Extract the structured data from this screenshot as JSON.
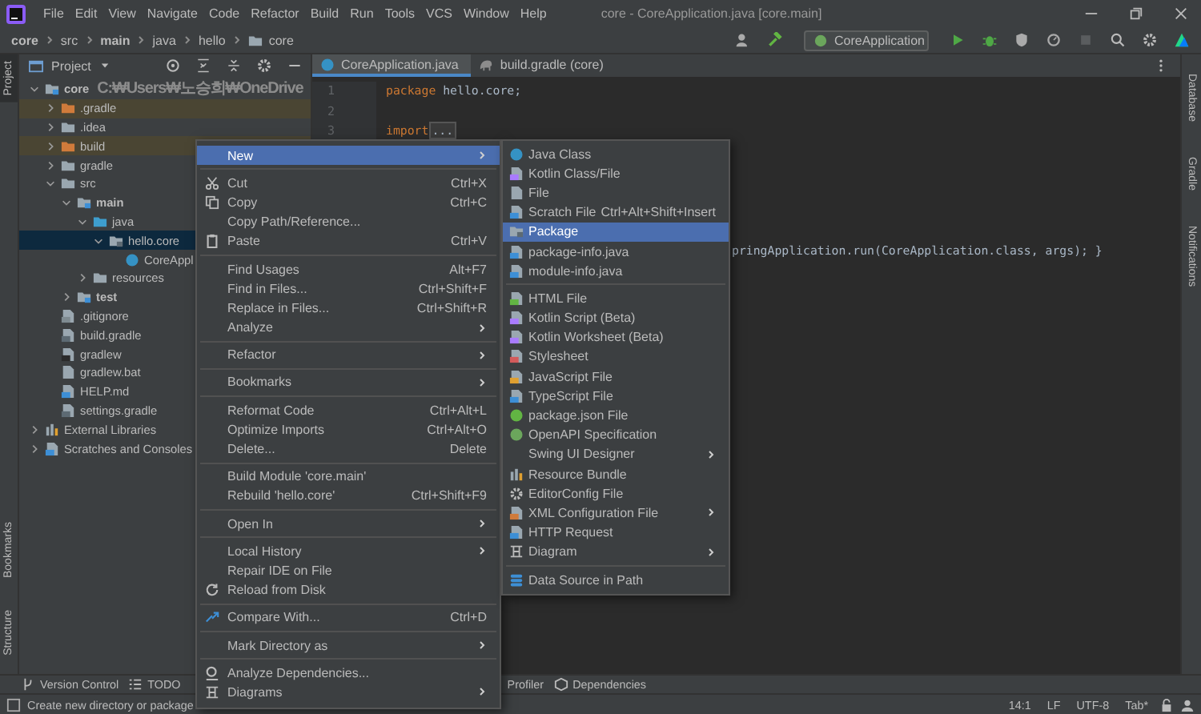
{
  "window": {
    "title": "core - CoreApplication.java [core.main]"
  },
  "menu_bar": [
    "File",
    "Edit",
    "View",
    "Navigate",
    "Code",
    "Refactor",
    "Build",
    "Run",
    "Tools",
    "VCS",
    "Window",
    "Help"
  ],
  "breadcrumbs": [
    {
      "label": "core",
      "kind": "module"
    },
    {
      "label": "src",
      "kind": "folder"
    },
    {
      "label": "main",
      "kind": "module"
    },
    {
      "label": "java",
      "kind": "folder"
    },
    {
      "label": "hello",
      "kind": "folder"
    },
    {
      "label": "core",
      "kind": "package"
    }
  ],
  "run_config": {
    "label": "CoreApplication"
  },
  "left_stripe": {
    "top": [
      {
        "label": "Project",
        "selected": true
      }
    ],
    "bottom": [
      {
        "label": "Bookmarks",
        "selected": false
      },
      {
        "label": "Structure",
        "selected": false
      }
    ]
  },
  "right_stripe": [
    "Database",
    "Gradle",
    "Notifications"
  ],
  "project_panel": {
    "title": "Project",
    "tree": [
      {
        "label": "core",
        "kind": "module",
        "path": "C:₩Users₩노승희₩OneDrive",
        "expanded": true,
        "selected": false,
        "children": [
          {
            "label": ".gradle",
            "kind": "excluded",
            "expanded": false,
            "selected": false
          },
          {
            "label": ".idea",
            "kind": "folder",
            "expanded": false,
            "selected": false
          },
          {
            "label": "build",
            "kind": "excluded",
            "expanded": false,
            "selected": false
          },
          {
            "label": "gradle",
            "kind": "folder",
            "expanded": false,
            "selected": false
          },
          {
            "label": "src",
            "kind": "folder",
            "expanded": true,
            "selected": false,
            "children": [
              {
                "label": "main",
                "kind": "source-set",
                "expanded": true,
                "selected": false,
                "children": [
                  {
                    "label": "java",
                    "kind": "java-root",
                    "expanded": true,
                    "selected": false,
                    "children": [
                      {
                        "label": "hello.core",
                        "kind": "package",
                        "expanded": true,
                        "selected": true,
                        "children": [
                          {
                            "label": "CoreAppl",
                            "kind": "class",
                            "selected": false
                          }
                        ]
                      }
                    ]
                  },
                  {
                    "label": "resources",
                    "kind": "folder",
                    "expanded": false,
                    "selected": false
                  }
                ]
              },
              {
                "label": "test",
                "kind": "source-set",
                "expanded": false,
                "selected": false
              }
            ]
          },
          {
            "label": ".gitignore",
            "kind": "gitignore",
            "selected": false
          },
          {
            "label": "build.gradle",
            "kind": "gradle",
            "selected": false
          },
          {
            "label": "gradlew",
            "kind": "script",
            "selected": false
          },
          {
            "label": "gradlew.bat",
            "kind": "batch",
            "selected": false
          },
          {
            "label": "HELP.md",
            "kind": "markdown",
            "selected": false
          },
          {
            "label": "settings.gradle",
            "kind": "gradle",
            "selected": false
          }
        ]
      },
      {
        "label": "External Libraries",
        "kind": "libraries",
        "expanded": false,
        "selected": false
      },
      {
        "label": "Scratches and Consoles",
        "kind": "scratches",
        "expanded": false,
        "selected": false
      }
    ]
  },
  "editor": {
    "tabs": [
      {
        "label": "CoreApplication.java",
        "kind": "java",
        "selected": true
      },
      {
        "label": "build.gradle (core)",
        "kind": "gradle",
        "selected": false
      }
    ],
    "lines": [
      {
        "number": "1",
        "tokens": [
          {
            "text": "package",
            "kind": "keyword"
          },
          {
            "text": " hello.core;",
            "kind": "plain"
          }
        ]
      },
      {
        "number": "2"
      },
      {
        "number": "3",
        "tokens": [
          {
            "text": "import",
            "kind": "keyword"
          },
          {
            "text": "...",
            "kind": "folded"
          }
        ]
      }
    ],
    "partial_line": "pringApplication.run(CoreApplication.class, args); }"
  },
  "context_menu": {
    "items": [
      {
        "kind": "plain",
        "label": "New",
        "submenu": true,
        "selected": true
      },
      {
        "kind": "separator"
      },
      {
        "kind": "cut",
        "label": "Cut",
        "shortcut": "Ctrl+X",
        "submenu": false,
        "selected": false
      },
      {
        "kind": "copy",
        "label": "Copy",
        "shortcut": "Ctrl+C",
        "submenu": false,
        "selected": false
      },
      {
        "kind": "plain",
        "label": "Copy Path/Reference...",
        "submenu": false,
        "selected": false
      },
      {
        "kind": "paste",
        "label": "Paste",
        "shortcut": "Ctrl+V",
        "submenu": false,
        "selected": false
      },
      {
        "kind": "separator"
      },
      {
        "kind": "plain",
        "label": "Find Usages",
        "shortcut": "Alt+F7",
        "submenu": false,
        "selected": false
      },
      {
        "kind": "plain",
        "label": "Find in Files...",
        "shortcut": "Ctrl+Shift+F",
        "submenu": false,
        "selected": false
      },
      {
        "kind": "plain",
        "label": "Replace in Files...",
        "shortcut": "Ctrl+Shift+R",
        "submenu": false,
        "selected": false
      },
      {
        "kind": "plain",
        "label": "Analyze",
        "submenu": true,
        "selected": false
      },
      {
        "kind": "separator"
      },
      {
        "kind": "plain",
        "label": "Refactor",
        "submenu": true,
        "selected": false
      },
      {
        "kind": "separator"
      },
      {
        "kind": "plain",
        "label": "Bookmarks",
        "submenu": true,
        "selected": false
      },
      {
        "kind": "separator"
      },
      {
        "kind": "plain",
        "label": "Reformat Code",
        "shortcut": "Ctrl+Alt+L",
        "submenu": false,
        "selected": false
      },
      {
        "kind": "plain",
        "label": "Optimize Imports",
        "shortcut": "Ctrl+Alt+O",
        "submenu": false,
        "selected": false
      },
      {
        "kind": "plain",
        "label": "Delete...",
        "shortcut": "Delete",
        "submenu": false,
        "selected": false
      },
      {
        "kind": "separator"
      },
      {
        "kind": "plain",
        "label": "Build Module 'core.main'",
        "submenu": false,
        "selected": false
      },
      {
        "kind": "plain",
        "label": "Rebuild 'hello.core'",
        "shortcut": "Ctrl+Shift+F9",
        "submenu": false,
        "selected": false
      },
      {
        "kind": "separator"
      },
      {
        "kind": "plain",
        "label": "Open In",
        "submenu": true,
        "selected": false
      },
      {
        "kind": "separator"
      },
      {
        "kind": "plain",
        "label": "Local History",
        "submenu": true,
        "selected": false
      },
      {
        "kind": "plain",
        "label": "Repair IDE on File",
        "submenu": false,
        "selected": false
      },
      {
        "kind": "reload",
        "label": "Reload from Disk",
        "submenu": false,
        "selected": false
      },
      {
        "kind": "separator"
      },
      {
        "kind": "compare",
        "label": "Compare With...",
        "shortcut": "Ctrl+D",
        "submenu": false,
        "selected": false
      },
      {
        "kind": "separator"
      },
      {
        "kind": "plain",
        "label": "Mark Directory as",
        "submenu": true,
        "selected": false
      },
      {
        "kind": "separator"
      },
      {
        "kind": "analyze",
        "label": "Analyze Dependencies...",
        "submenu": false,
        "selected": false
      },
      {
        "kind": "diagram",
        "label": "Diagrams",
        "submenu": true,
        "selected": false
      }
    ]
  },
  "submenu": {
    "items": [
      {
        "kind": "java-class",
        "label": "Java Class",
        "submenu": false,
        "selected": false
      },
      {
        "kind": "kotlin",
        "label": "Kotlin Class/File",
        "submenu": false,
        "selected": false
      },
      {
        "kind": "file",
        "label": "File",
        "submenu": false,
        "selected": false
      },
      {
        "kind": "scratch",
        "label": "Scratch File",
        "shortcut": "Ctrl+Alt+Shift+Insert",
        "submenu": false,
        "selected": false
      },
      {
        "kind": "package",
        "label": "Package",
        "submenu": false,
        "selected": true
      },
      {
        "kind": "java-file",
        "label": "package-info.java",
        "submenu": false,
        "selected": false
      },
      {
        "kind": "java-file",
        "label": "module-info.java",
        "submenu": false,
        "selected": false
      },
      {
        "kind": "separator"
      },
      {
        "kind": "html",
        "label": "HTML File",
        "submenu": false,
        "selected": false
      },
      {
        "kind": "kotlin",
        "label": "Kotlin Script (Beta)",
        "submenu": false,
        "selected": false
      },
      {
        "kind": "kotlin",
        "label": "Kotlin Worksheet (Beta)",
        "submenu": false,
        "selected": false
      },
      {
        "kind": "stylesheet",
        "label": "Stylesheet",
        "submenu": false,
        "selected": false
      },
      {
        "kind": "javascript",
        "label": "JavaScript File",
        "submenu": false,
        "selected": false
      },
      {
        "kind": "typescript",
        "label": "TypeScript File",
        "submenu": false,
        "selected": false
      },
      {
        "kind": "json",
        "label": "package.json File",
        "submenu": false,
        "selected": false
      },
      {
        "kind": "openapi",
        "label": "OpenAPI Specification",
        "submenu": false,
        "selected": false
      },
      {
        "kind": "plain",
        "label": "Swing UI Designer",
        "submenu": true,
        "selected": false
      },
      {
        "kind": "bundle",
        "label": "Resource Bundle",
        "submenu": false,
        "selected": false
      },
      {
        "kind": "editorconfig",
        "label": "EditorConfig File",
        "submenu": false,
        "selected": false
      },
      {
        "kind": "xml",
        "label": "XML Configuration File",
        "submenu": true,
        "selected": false
      },
      {
        "kind": "http",
        "label": "HTTP Request",
        "submenu": false,
        "selected": false
      },
      {
        "kind": "diagram",
        "label": "Diagram",
        "submenu": true,
        "selected": false
      },
      {
        "kind": "separator"
      },
      {
        "kind": "data-source",
        "label": "Data Source in Path",
        "submenu": false,
        "selected": false
      }
    ]
  },
  "tool_windows": {
    "left": [
      {
        "label": "Version Control",
        "kind": "branch"
      },
      {
        "label": "TODO",
        "kind": "list"
      }
    ],
    "right": [
      {
        "label": "Profiler",
        "kind": "plain"
      },
      {
        "label": "Dependencies",
        "kind": "deps"
      }
    ]
  },
  "status_bar": {
    "message": "Create new directory or package",
    "widgets": [
      "14:1",
      "LF",
      "UTF-8",
      "Tab*"
    ]
  }
}
